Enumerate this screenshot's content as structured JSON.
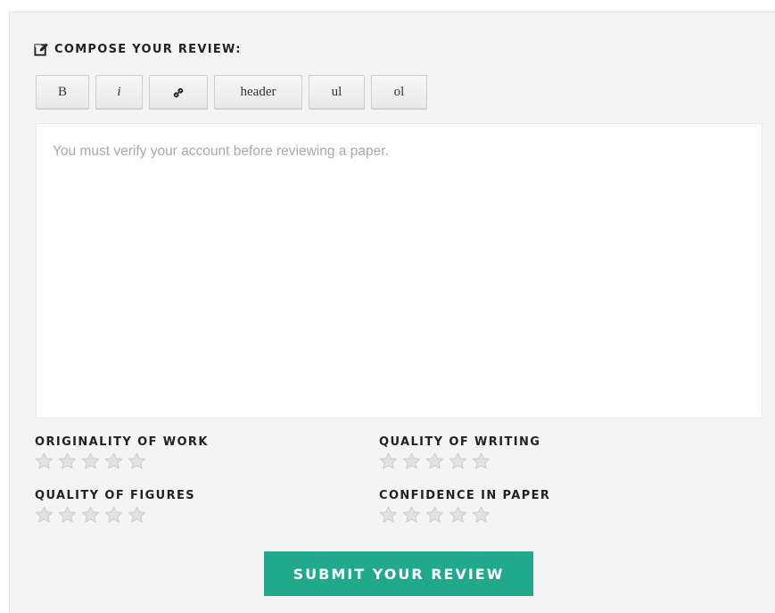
{
  "compose": {
    "heading": "COMPOSE YOUR REVIEW:",
    "icon": "edit-icon"
  },
  "toolbar": {
    "bold_label": "B",
    "italic_label": "i",
    "link_icon": "link-icon",
    "header_label": "header",
    "ul_label": "ul",
    "ol_label": "ol"
  },
  "editor": {
    "placeholder": "You must verify your account before reviewing a paper.",
    "value": ""
  },
  "ratings": [
    {
      "label": "ORIGINALITY OF WORK",
      "value": 0,
      "max": 5
    },
    {
      "label": "QUALITY OF WRITING",
      "value": 0,
      "max": 5
    },
    {
      "label": "QUALITY OF FIGURES",
      "value": 0,
      "max": 5
    },
    {
      "label": "CONFIDENCE IN PAPER",
      "value": 0,
      "max": 5
    }
  ],
  "submit": {
    "label": "SUBMIT YOUR REVIEW"
  },
  "colors": {
    "accent": "#20a98b",
    "panel_bg": "#f4f4f4",
    "star_empty": "#e2e2e2"
  }
}
